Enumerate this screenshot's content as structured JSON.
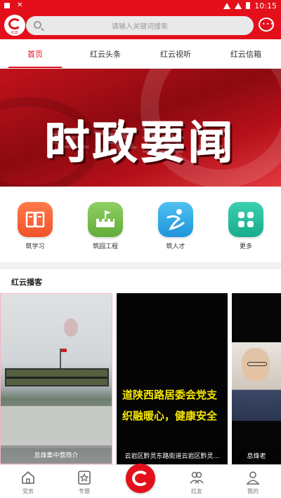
{
  "status_bar": {
    "time": "10:15"
  },
  "header": {
    "search_placeholder": "请输入关键词搜索",
    "logo_text": "红云"
  },
  "tabs": [
    {
      "label": "首页",
      "active": true
    },
    {
      "label": "红云头条",
      "active": false
    },
    {
      "label": "红云视听",
      "active": false
    },
    {
      "label": "红云信箱",
      "active": false
    }
  ],
  "banner": {
    "title": "时政要闻"
  },
  "shortcuts": [
    {
      "label": "筑学习",
      "icon": "book-icon",
      "color": "#f2522a"
    },
    {
      "label": "筑园工程",
      "icon": "castle-flag-icon",
      "color": "#62ad3a"
    },
    {
      "label": "筑人才",
      "icon": "person-run-icon",
      "color": "#1f95db"
    },
    {
      "label": "更多",
      "icon": "grid-more-icon",
      "color": "#17ac8c"
    }
  ],
  "section": {
    "title": "红云播客"
  },
  "videos": [
    {
      "caption": "息烽集中营简介"
    },
    {
      "caption": "云岩区黔灵东路街道云岩区黔灵…",
      "subtitle_line1": "道陕西路居委会党支",
      "subtitle_line2": "织融暖心，健康安全"
    },
    {
      "caption": "息烽老"
    }
  ],
  "bottom_nav": [
    {
      "label": "党务",
      "icon": "home-icon"
    },
    {
      "label": "专题",
      "icon": "star-doc-icon"
    },
    {
      "label": "",
      "icon": "hongyun-logo-icon"
    },
    {
      "label": "红友",
      "icon": "friends-icon"
    },
    {
      "label": "我的",
      "icon": "user-icon"
    }
  ]
}
